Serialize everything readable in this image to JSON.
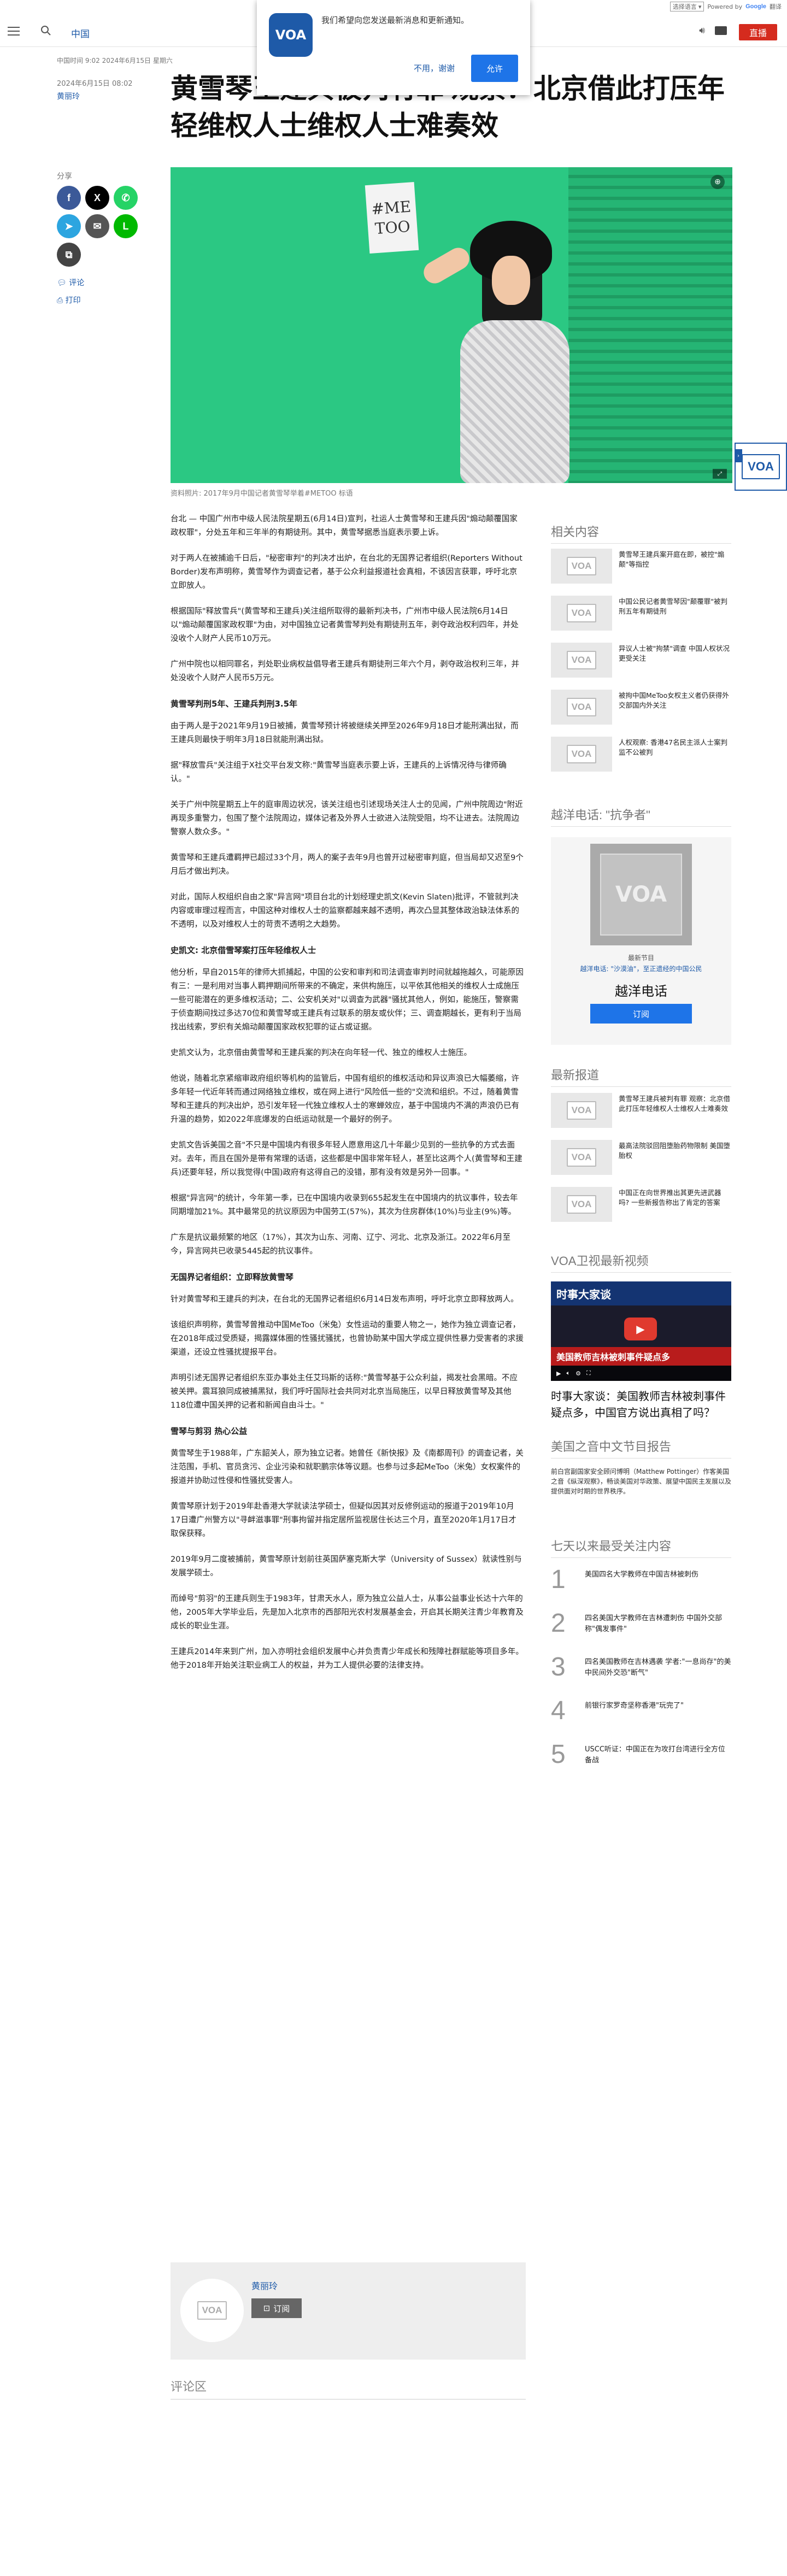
{
  "translate": {
    "select_label": "选择语言",
    "powered": "Powered by",
    "google": "Google",
    "translate_word": "翻译"
  },
  "header": {
    "nav_label": "中国",
    "live_label": "直播"
  },
  "notification": {
    "message": "我们希望向您发送最新消息和更新通知。",
    "deny": "不用，谢谢",
    "allow": "允许"
  },
  "meta": {
    "dateline": "中国时间 9:02 2024年6月15日 星期六",
    "date2": "2024年6月15日 08:02",
    "author": "黄丽玲"
  },
  "headline": "黄雪琴王建兵被判有罪 观察：北京借此打压年轻维权人士维权人士难奏效",
  "share": {
    "label": "分享",
    "comment": "评论",
    "print": "打印"
  },
  "hero": {
    "sign_text": "#ME TOO",
    "caption": "资料照片: 2017年9月中国记者黄雪琴举着#METOO 标语"
  },
  "article": {
    "p1": "台北 — 中国广州市中级人民法院星期五(6月14日)宣判，社运人士黄雪琴和王建兵因\"煽动颠覆国家政权罪\"，分处五年和三年半的有期徒刑。其中，黄雪琴据悉当庭表示要上诉。",
    "p2": "对于两人在被捕逾千日后，\"秘密审判\"的判决才出炉，在台北的无国界记者组织(Reporters Without Border)发布声明称，黄雪琴作为调查记者，基于公众利益报道社会真相，不该因言获罪，呼吁北京立即放人。",
    "p3": "根据国际\"释放雪兵\"(黄雪琴和王建兵)关注组所取得的最新判决书，广州市中级人民法院6月14日以\"煽动颠覆国家政权罪\"为由，对中国独立记者黄雪琴判处有期徒刑五年，剥夺政治权利四年，并处没收个人财产人民币10万元。",
    "p4": "广州中院也以相同罪名，判处职业病权益倡导者王建兵有期徒刑三年六个月，剥夺政治权利三年，并处没收个人财产人民币5万元。",
    "h1": "黄雪琴判刑5年、王建兵判刑3.5年",
    "p5": "由于两人是于2021年9月19日被捕，黄雪琴预计将被继续关押至2026年9月18日才能刑满出狱，而王建兵则最快于明年3月18日就能刑满出狱。",
    "p6": "据\"释放雪兵\"关注组于X社交平台发文称:\"黄雪琴当庭表示要上诉，王建兵的上诉情况待与律师确认。\"",
    "p7": "关于广州中院星期五上午的庭审周边状况，该关注组也引述现场关注人士的见闻，广州中院周边\"附近再现多重警力，包围了整个法院周边，媒体记者及外界人士欲进入法院受阻，均不让进去。法院周边警察人数众多。\"",
    "p8": "黄雪琴和王建兵遭羁押已超过33个月，两人的案子去年9月也曾开过秘密审判庭，但当局却又迟至9个月后才做出判决。",
    "p9": "对此，国际人权组织自由之家\"异言网\"项目台北的计划经理史凯文(Kevin Slaten)批评，不管就判决内容或审理过程而言，中国这种对维权人士的监察都越来越不透明，再次凸显其整体政治缺法体系的不透明，以及对维权人士的苛责不透明之大趋势。",
    "h2": "史凯文: 北京借雪琴案打压年轻维权人士",
    "p10": "他分析，早自2015年的律师大抓捕起，中国的公安和审判和司法调查审判时间就越拖越久，可能原因有三：一是利用对当事人羁押期间所带来的不确定，来供构施压，以平依其他相关的维权人士成施压一些可能潜在的更多维权活动；二、公安机关对\"以调查为武器\"骚扰其他人，例如，能施压，警察需于侦查期间找过多达70位和黄雪琴或王建兵有过联系的朋友或伙伴；三、调查期越长，更有利于当局找出线索，罗织有关煽动颠覆国家政权犯罪的证占或证据。",
    "p11": "史凯文认为，北京借由黄雪琴和王建兵案的判决在向年轻一代、独立的维权人士施压。",
    "p12": "他说，随着北京紧缩审政府组织等机构的监管后，中国有组织的维权活动和异议声浪已大幅萎缩，许多年轻一代近年转而通过网络独立维权，或在网上进行\"风险低一些的\"交流和组织。不过，随着黄雪琴和王建兵的判决出炉，恐引发年轻一代独立维权人士的寒蝉效应，基于中国境内不满的声浪仍已有升温的趋势，如2022年底爆发的白纸运动就是一个最好的例子。",
    "p13": "史凯文告诉美国之音\"不只是中国境内有很多年轻人愿意用这几十年最少见到的一些抗争的方式去面对。去年，而且在国外是带有常理的话语，这些都是中国非常年轻人，甚至比这两个人(黄雪琴和王建兵)还要年轻，所以我觉得(中国)政府有这得自己的没错，那有没有效是另外一回事。\"",
    "p14": "根据\"异言网\"的统计，今年第一季，已在中国境内收录到655起发生在中国境内的抗议事件，较去年同期增加21%。其中最常见的抗议原因为中国劳工(57%)，其次为住房群体(10%)与业主(9%)等。",
    "p15": "广东是抗议最频繁的地区（17%），其次为山东、河南、辽宁、河北、北京及浙江。2022年6月至今，异言网共已收录5445起的抗议事件。",
    "h3": "无国界记者组织：立即释放黄雪琴",
    "p16": "针对黄雪琴和王建兵的判决，在台北的无国界记者组织6月14日发布声明，呼吁北京立即释放两人。",
    "p17": "该组织声明称，黄雪琴曾推动中国MeToo（米兔）女性运动的重要人物之一，她作为独立调查记者，在2018年成过受质疑，揭露媒体圈的性骚扰骚扰，也曾协助某中国大学成立提供性暴力受害者的求援渠道，还设立性骚扰提报平台。",
    "p18": "声明引述无国界记者组织东亚办事处主任艾玛斯的话称:\"黄雪琴基于公众利益，揭发社会黑暗。不应被关押。震耳狼同成被捕黑狱，我们呼吁国际社会共同对北京当局施压，以早日释放黄雪琴及其他118位遭中国关押的记者和新闻自由斗士。\"",
    "h4": "雪琴与剪羽 热心公益",
    "p19": "黄雪琴生于1988年，广东韶关人，原为独立记者。她曾任《新快报》及《南都周刊》的调查记者，关注范围，手机、官员贪污、企业污染和就职鹏宗体等议题。也参与过多起MeToo（米兔）女权案件的报道并协助过性侵和性骚扰受害人。",
    "p20": "黄雪琴原计划于2019年赴香港大学就读法学硕士，但疑似因其对反修例运动的报道于2019年10月17日遭广州警方以\"寻衅滋事罪\"刑事拘留并指定居所监视居住长达三个月，直至2020年1月17日才取保获释。",
    "p21": "2019年9月二度被捕前，黄雪琴原计划前往英国萨塞克斯大学（University of Sussex）就读性别与发展学硕士。",
    "p22": "而绰号\"剪羽\"的王建兵则生于1983年，甘肃天水人，原为独立公益人士，从事公益事业长达十六年的他，2005年大学毕业后，先是加入北京市的西部阳光农村发展基金会，开启其长期关注青少年教育及成长的职业生涯。",
    "p23": "王建兵2014年来到广州，加入亦明社会组织发展中心并负责青少年成长和残障社群赋能等项目多年。他于2018年开始关注职业病工人的权益，并为工人提供必要的法律支持。"
  },
  "author_box": {
    "name": "黄丽玲",
    "subscribe": "订阅"
  },
  "comments": {
    "title": "评论区"
  },
  "sidebar": {
    "related_title": "相关内容",
    "related": [
      "黄雪琴王建兵案开庭在即，被控\"煽颠\"等指控",
      "中国公民记者黄雪琴因\"颠覆罪\"被判刑五年有期徒刑",
      "异议人士被\"拘禁\"调查 中国人权状况更受关注",
      "被拘中国MeToo女权主义者仍获得外交部国内外关注",
      "人权观察: 香港47名民主派人士案判监不公被判"
    ],
    "radio_title": "越洋电话: \"抗争者\"",
    "radio_l1": "最新节目",
    "radio_l2": "越洋电话: \"沙漠油\"，至正遗经的中国公民",
    "radio_name": "越洋电话",
    "radio_btn": "订阅",
    "latest_title": "最新报道",
    "latest": [
      "黄雪琴王建兵被判有罪 观察：北京借此打压年轻维权人士维权人士难奏效",
      "最高法院驳回阻堕胎药物限制 美国堕胎权",
      "中国正在向世界推出其更先进武器吗? 一些新报告称出了肯定的答案"
    ],
    "video_title": "VOA卫视最新视频",
    "video_banner": "时事大家谈",
    "video_red": "美国教师吉林被刺事件疑点多",
    "video_caption": "时事大家谈：美国教师吉林被刺事件疑点多，中国官方说出真相了吗？",
    "report_title": "美国之音中文节目报告",
    "report_text": "前白宫副国家安全顾问博明（Matthew Pottinger）作客美国之音《纵深观察》，畅谈美国对华政策、展望中国民主发展以及提供面对时期的世界秩序。",
    "top_title": "七天以来最受关注内容",
    "top": [
      {
        "num": "1",
        "text": "美国四名大学教师在中国吉林被刺伤"
      },
      {
        "num": "2",
        "text": "四名美国大学教师在吉林遭刺伤 中国外交部称\"偶发事件\""
      },
      {
        "num": "3",
        "text": "四名美国教师在吉林遇袭 学者:\"一息尚存\"的美中民间外交恐\"断气\""
      },
      {
        "num": "4",
        "text": "前银行家罗奇坚称香港\"玩完了\""
      },
      {
        "num": "5",
        "text": "USCC听证：中国正在为攻打台湾进行全方位备战"
      }
    ]
  },
  "logo_text": "VOA",
  "colors": {
    "accent": "#1e5aa8",
    "live": "#d52b1e",
    "button": "#1e74e8"
  }
}
